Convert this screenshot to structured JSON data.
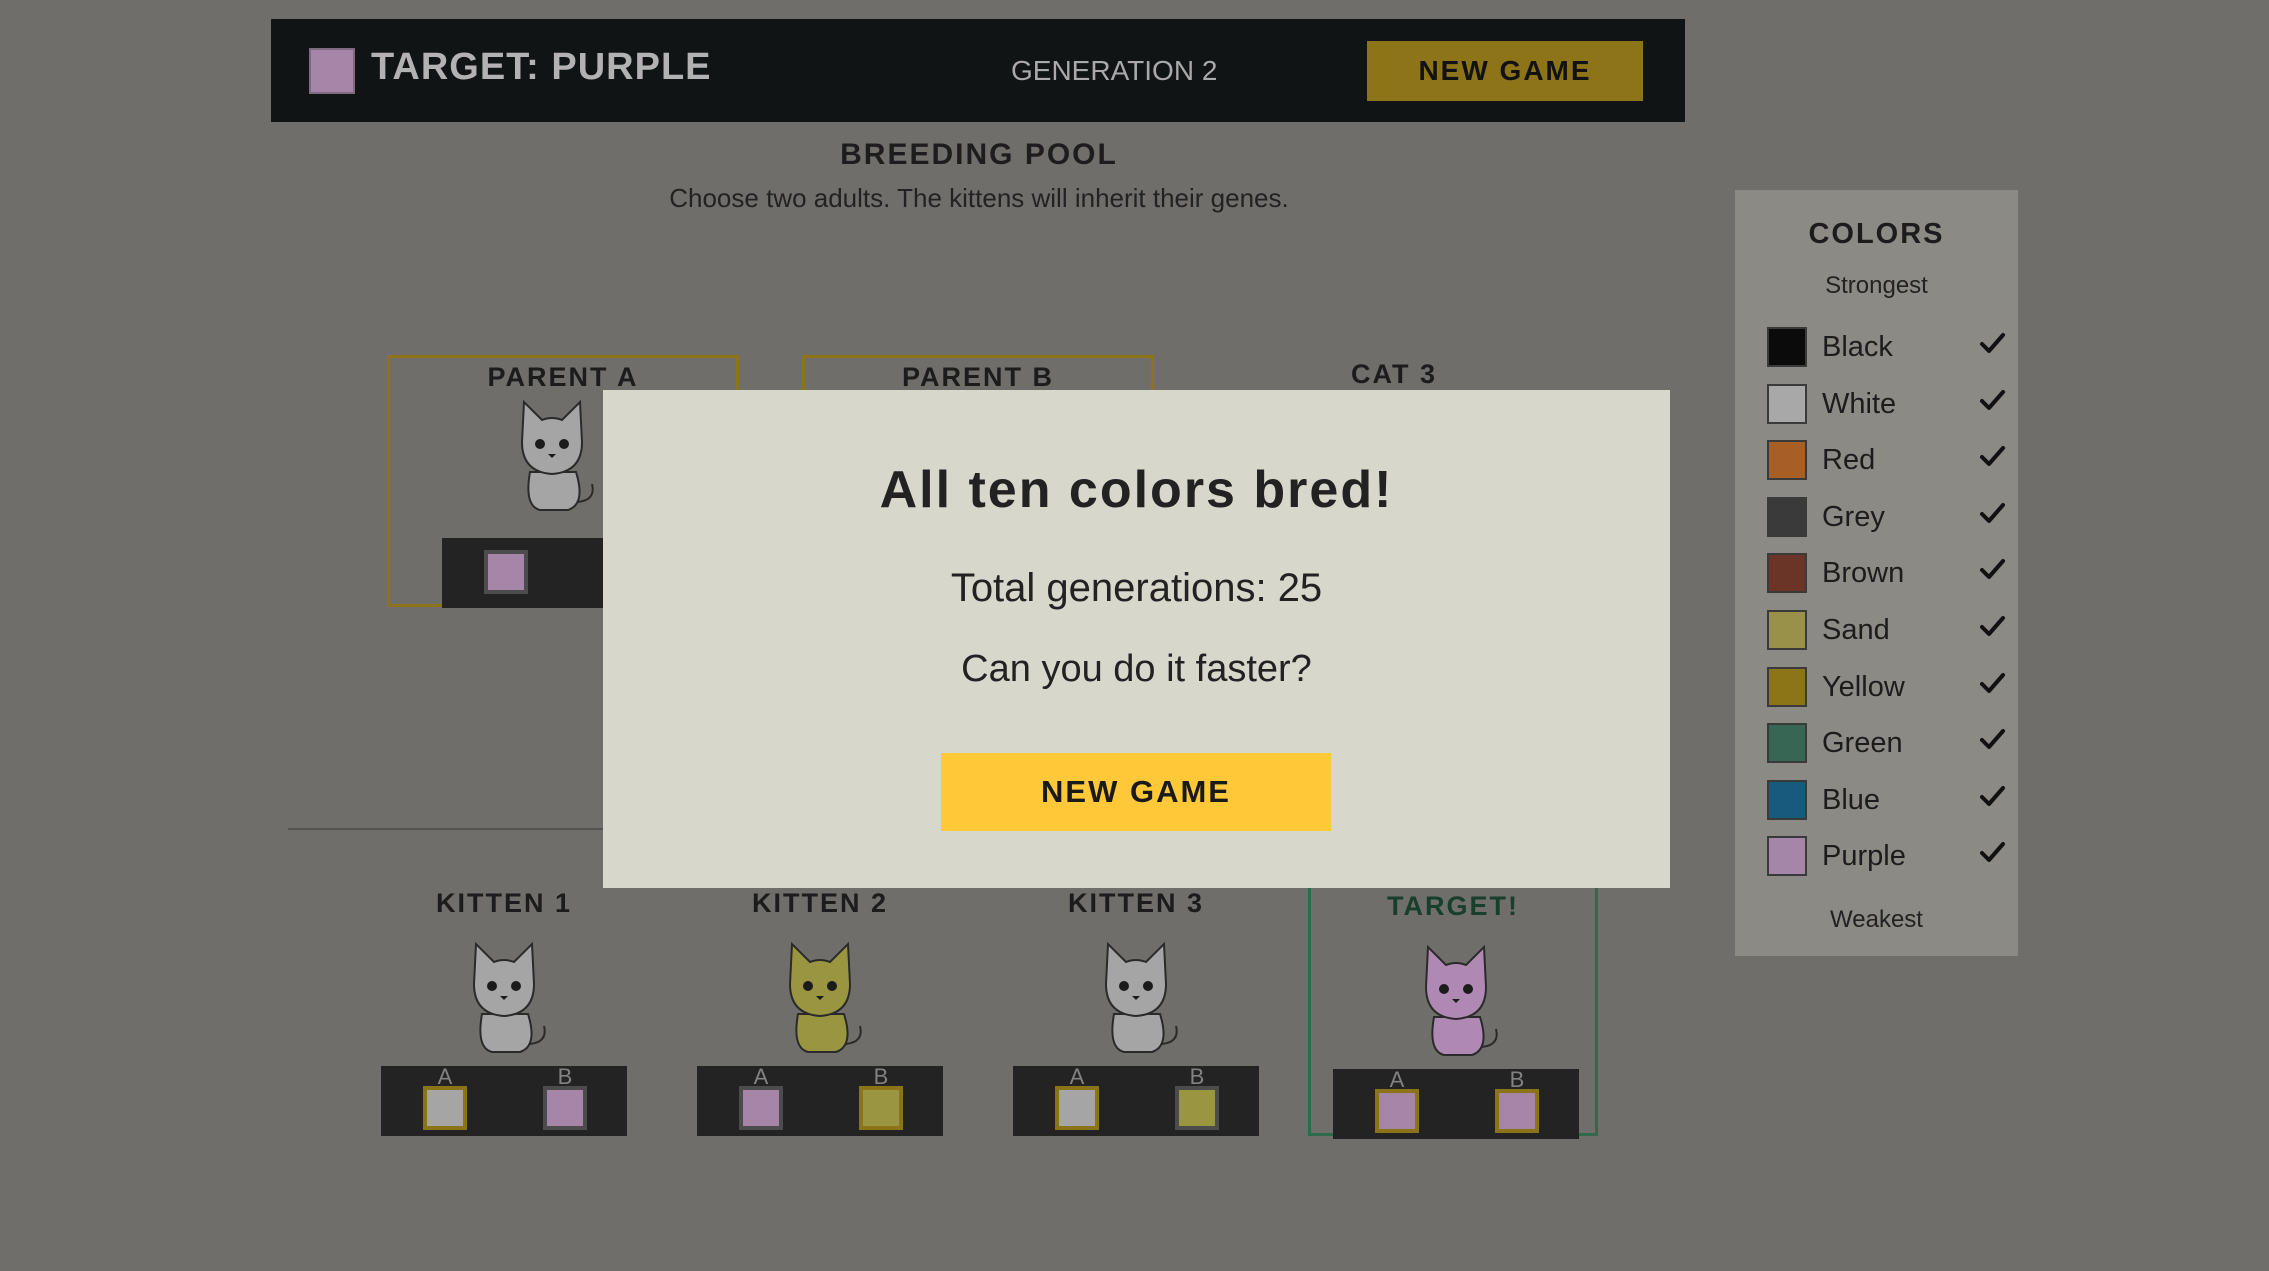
{
  "header": {
    "target_label": "TARGET: PURPLE",
    "target_color": "#a686a8",
    "generation": "GENERATION 2",
    "new_game_label": "NEW GAME"
  },
  "pool": {
    "title": "BREEDING POOL",
    "subtitle": "Choose two adults. The kittens will inherit their genes.",
    "adults": [
      {
        "label": "PARENT A",
        "selected": true,
        "fur": "#a5a5a5"
      },
      {
        "label": "PARENT B",
        "selected": true
      },
      {
        "label": "CAT 3",
        "selected": false
      }
    ]
  },
  "kittens": [
    {
      "label": "KITTEN 1",
      "fur": "#a5a5a5",
      "gene_a": "#a5a5a5",
      "gene_b": "#a686a8",
      "dominant": "A"
    },
    {
      "label": "KITTEN 2",
      "fur": "#9a9540",
      "gene_a": "#a686a8",
      "gene_b": "#9a9540",
      "dominant": "B"
    },
    {
      "label": "KITTEN 3",
      "fur": "#a5a5a5",
      "gene_a": "#a5a5a5",
      "gene_b": "#9a9540",
      "dominant": "A"
    },
    {
      "label": "TARGET!",
      "fur": "#b088b4",
      "gene_a": "#a686a8",
      "gene_b": "#a686a8",
      "dominant": "AB",
      "is_target": true
    }
  ],
  "gene_labels": {
    "a": "A",
    "b": "B"
  },
  "colors_panel": {
    "title": "COLORS",
    "strongest": "Strongest",
    "weakest": "Weakest",
    "items": [
      {
        "name": "Black",
        "color": "#0b0b0b",
        "done": true
      },
      {
        "name": "White",
        "color": "#a8a8a8",
        "done": true
      },
      {
        "name": "Red",
        "color": "#a85f26",
        "done": true
      },
      {
        "name": "Grey",
        "color": "#3a3a3a",
        "done": true
      },
      {
        "name": "Brown",
        "color": "#6a3427",
        "done": true
      },
      {
        "name": "Sand",
        "color": "#99914a",
        "done": true
      },
      {
        "name": "Yellow",
        "color": "#8c7419",
        "done": true
      },
      {
        "name": "Green",
        "color": "#376754",
        "done": true
      },
      {
        "name": "Blue",
        "color": "#175a7d",
        "done": true
      },
      {
        "name": "Purple",
        "color": "#a686a8",
        "done": true
      }
    ]
  },
  "modal": {
    "title": "All ten colors bred!",
    "generations": "Total generations: 25",
    "question": "Can you do it faster?",
    "button_label": "NEW GAME"
  }
}
